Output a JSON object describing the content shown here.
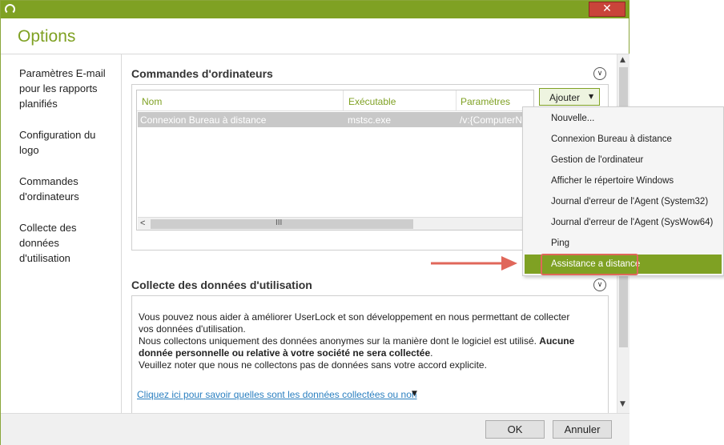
{
  "window": {
    "title_icon": "userlock-ring-icon",
    "close_glyph": "✕"
  },
  "header": {
    "title": "Options"
  },
  "sidebar": {
    "items": [
      {
        "lines": [
          "Paramètres E-mail",
          "pour les rapports",
          "planifiés"
        ]
      },
      {
        "lines": [
          "Configuration du",
          "logo"
        ]
      },
      {
        "lines": [
          "Commandes",
          "d'ordinateurs"
        ]
      },
      {
        "lines": [
          "Collecte des",
          "données",
          "d'utilisation"
        ]
      }
    ]
  },
  "commands": {
    "title": "Commandes d'ordinateurs",
    "add_label": "Ajouter",
    "columns": [
      "Nom",
      "Exécutable",
      "Paramètres"
    ],
    "rows": [
      {
        "name": "Connexion Bureau à distance",
        "exe": "mstsc.exe",
        "params": "/v:{ComputerName}"
      }
    ],
    "scroll_grip": "III"
  },
  "menu": {
    "items": [
      "Nouvelle...",
      "Connexion Bureau à distance",
      "Gestion de l'ordinateur",
      "Afficher le répertoire Windows",
      "Journal d'erreur de l'Agent (System32)",
      "Journal d'erreur de l'Agent (SysWow64)",
      "Ping",
      "Assistance a distance"
    ],
    "active_index": 7
  },
  "usage": {
    "title": "Collecte des données d'utilisation",
    "p1": "Vous pouvez nous aider à améliorer UserLock et son développement en nous permettant de collecter vos données d'utilisation.",
    "p2_normal": "Nous collectons uniquement des données anonymes sur la manière dont le logiciel est utilisé. ",
    "p2_bold": "Aucune donnée personnelle ou relative à votre société ne sera collectée",
    "p2_end": ".",
    "p3": "Veuillez noter que nous ne collectons pas de données sans votre accord explicite.",
    "link": "Cliquez ici pour savoir quelles sont les données collectées ou non"
  },
  "footer": {
    "ok": "OK",
    "cancel": "Annuler"
  },
  "colors": {
    "accent": "#7fa123",
    "close": "#c9443a",
    "callout": "#e0675a"
  }
}
